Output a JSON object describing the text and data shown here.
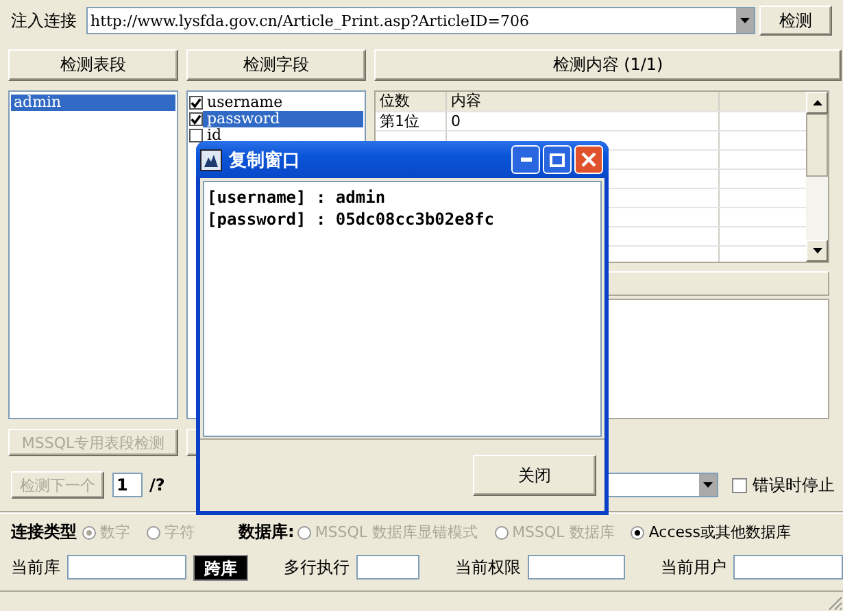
{
  "url_label": "注入连接",
  "url": {
    "value": "http://www.lysfda.gov.cn/Article_Print.asp?ArticleID=706"
  },
  "detect_button": "检测",
  "headers": [
    "检测表段",
    "检测字段",
    "检测内容 (1/1)"
  ],
  "tables": [
    {
      "label": "admin",
      "selected": true
    }
  ],
  "fields": [
    {
      "label": "username",
      "checked": true,
      "selected": false
    },
    {
      "label": "password",
      "checked": true,
      "selected": true
    },
    {
      "label": "id",
      "checked": false,
      "selected": false
    }
  ],
  "content": {
    "columns": [
      "位数",
      "内容"
    ],
    "rows": [
      [
        "第1位",
        "0"
      ]
    ]
  },
  "mssql_button": {
    "label": "MSSQL专用表段检测",
    "disabled": true
  },
  "next_button": {
    "label": "检测下一个",
    "disabled": true
  },
  "index_field": {
    "value": "1"
  },
  "total": "/?",
  "stop_on_error": {
    "label": "错误时停止",
    "checked": false
  },
  "connection": {
    "label": "连接类型",
    "options": [
      {
        "label": "数字",
        "selected": true,
        "disabled": true
      },
      {
        "label": "字符",
        "selected": false,
        "disabled": true
      }
    ]
  },
  "database": {
    "label": "数据库:",
    "options": [
      {
        "label": "MSSQL 数据库显错模式",
        "selected": false,
        "disabled": true
      },
      {
        "label": "MSSQL 数据库",
        "selected": false,
        "disabled": true
      },
      {
        "label": "Access或其他数据库",
        "selected": true,
        "disabled": false
      }
    ]
  },
  "current_db_label": "当前库",
  "cross_db_button": "跨库",
  "multi_exec_label": "多行执行",
  "privilege_label": "当前权限",
  "user_label": "当前用户",
  "dialog": {
    "title": "复制窗口",
    "lines": [
      "[username] : admin",
      "[password] : 05dc08cc3b02e8fc"
    ],
    "close_button": "关闭"
  }
}
